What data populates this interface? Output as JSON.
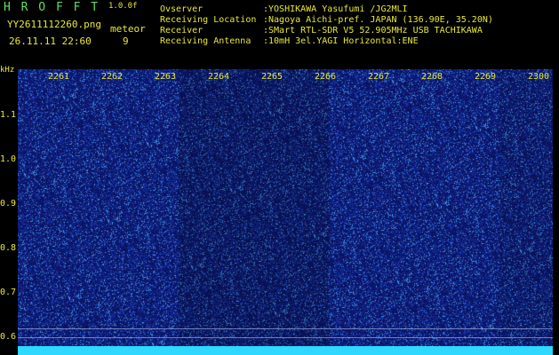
{
  "header": {
    "app_title": "H R O F F T",
    "version": "1.0.0f",
    "filename": "YY2611112260.png",
    "datetime": "26.11.11 22:60",
    "meteor_label": "meteor",
    "meteor_count": "9"
  },
  "info": [
    {
      "label": "Ovserver",
      "value": ":YOSHIKAWA Yasufumi /JG2MLI"
    },
    {
      "label": "Receiving Location",
      "value": ":Nagoya Aichi-pref. JAPAN (136.90E, 35.20N)"
    },
    {
      "label": "Receiver",
      "value": ":SMart RTL-SDR V5 52.905MHz USB TACHIKAWA"
    },
    {
      "label": "Receiving Antenna",
      "value": ":10mH 3el.YAGI Horizontal:ENE"
    }
  ],
  "axis": {
    "unit": "kHz",
    "y_ticks": [
      "1.1",
      "1.0",
      "0.9",
      "0.8",
      "0.7",
      "0.6"
    ],
    "time_ticks": [
      "2261",
      "2262",
      "2263",
      "2264",
      "2265",
      "2266",
      "2267",
      "2268",
      "2269",
      "2300"
    ]
  },
  "colors": {
    "background": "#0b1560",
    "text": "#e8e83a",
    "title": "#5fe05f",
    "noise_floor": "#2fd8ff"
  }
}
